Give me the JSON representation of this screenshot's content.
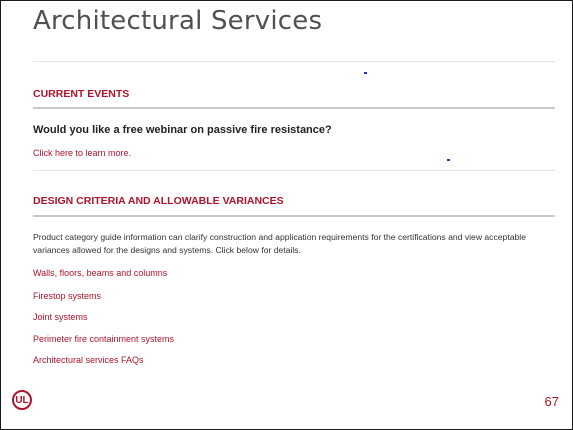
{
  "page": {
    "title": "Architectural Services",
    "page_number": "67",
    "logo_text": "UL",
    "accent_color": "#b0142c"
  },
  "current_events": {
    "heading": "CURRENT EVENTS",
    "question": "Would you like a free webinar on passive fire resistance?",
    "link": "Click here to learn more."
  },
  "design_criteria": {
    "heading": "DESIGN CRITERIA AND ALLOWABLE VARIANCES",
    "body": "Product category guide information can clarify construction and application requirements for the certifications and view acceptable variances allowed for the designs and systems. Click below for details.",
    "links": [
      "Walls, floors, beams and columns",
      "Firestop systems",
      "Joint systems",
      "Perimeter fire containment systems",
      "Architectural services FAQs"
    ]
  }
}
